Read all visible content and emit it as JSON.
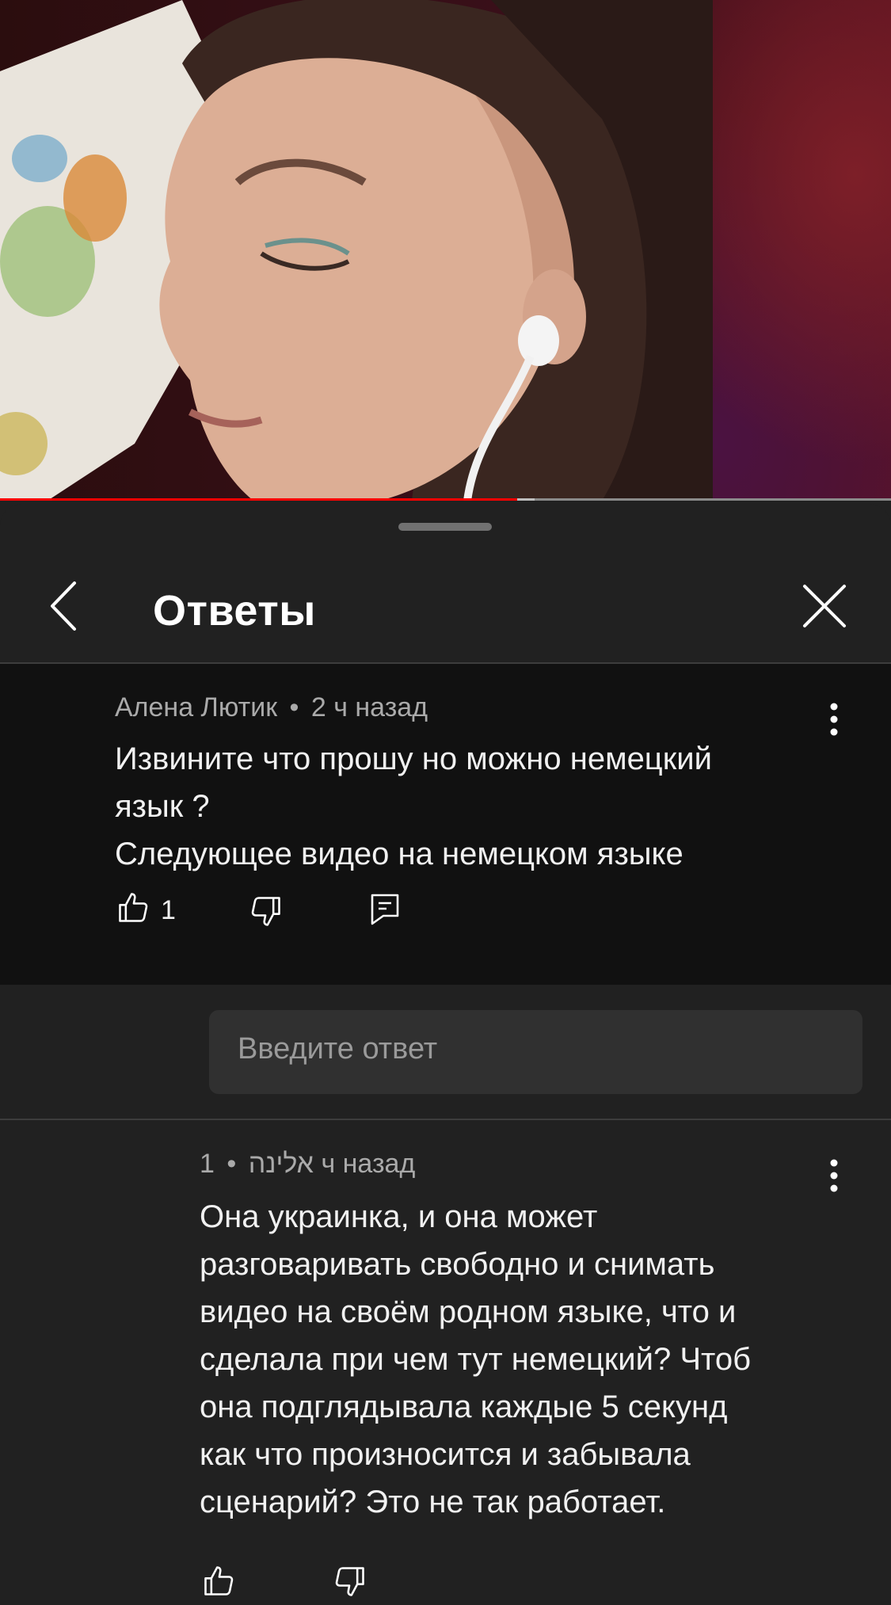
{
  "video": {
    "progress_played": 0.58,
    "progress_buffered": 0.6
  },
  "header": {
    "title": "Ответы",
    "back_icon": "chevron-left-icon",
    "close_icon": "close-icon"
  },
  "parent_comment": {
    "author": "Алена Лютик",
    "separator": "•",
    "time": "2 ч назад",
    "lines": [
      "Извините что прошу но можно немецкий",
      "язык ?",
      "Следующее видео на немецком языке"
    ],
    "likes": "1"
  },
  "reply_input": {
    "placeholder": "Введите ответ"
  },
  "reply": {
    "author": "אלינה",
    "separator": "•",
    "time": "1 ч назад",
    "lines": [
      "Она украинка, и она может",
      "разговаривать свободно и снимать",
      "видео на своём родном языке, что и",
      "сделала при чем тут немецкий? Чтоб",
      "она подглядывала каждые 5 секунд",
      "как что произносится и забывала",
      "сценарий? Это не так работает."
    ]
  },
  "colors": {
    "accent": "#ff0000",
    "sheet_bg": "#212121",
    "highlight_bg": "#111111"
  }
}
